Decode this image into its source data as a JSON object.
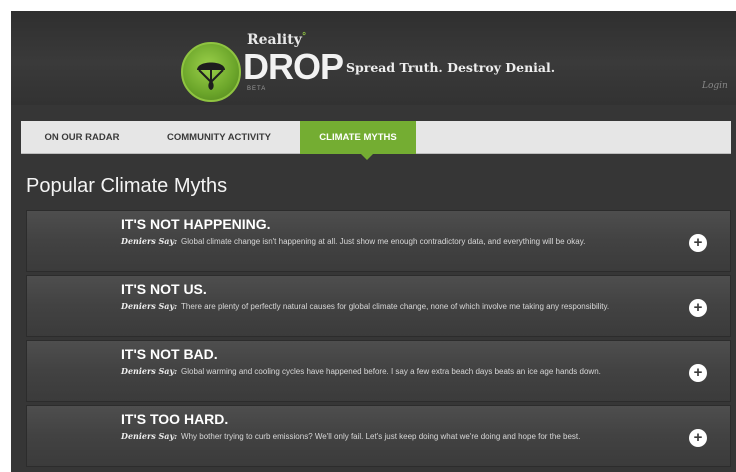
{
  "header": {
    "brand_small": "Reality",
    "brand_degree": "°",
    "brand_big": "DROP",
    "brand_beta": "BETA",
    "tagline": "Spread Truth. Destroy Denial.",
    "login_label": "Login"
  },
  "nav": {
    "tabs": [
      {
        "label": "ON OUR RADAR"
      },
      {
        "label": "COMMUNITY ACTIVITY"
      },
      {
        "label": "CLIMATE MYTHS"
      }
    ]
  },
  "main": {
    "title": "Popular Climate Myths",
    "lead_label": "Deniers Say:",
    "myths": [
      {
        "title": "IT'S NOT HAPPENING.",
        "text": "Global climate change isn't happening at all. Just show me enough contradictory data, and everything will be okay."
      },
      {
        "title": "IT'S NOT US.",
        "text": "There are plenty of perfectly natural causes for global climate change, none of which involve me taking any responsibility."
      },
      {
        "title": "IT'S NOT BAD.",
        "text": "Global warming and cooling cycles have happened before. I say a few extra beach days beats an ice age hands down."
      },
      {
        "title": "IT'S TOO HARD.",
        "text": "Why bother trying to curb emissions? We'll only fail. Let's just keep doing what we're doing and hope for the best."
      }
    ],
    "expand_symbol": "+"
  },
  "colors": {
    "accent": "#74ad32",
    "background": "#363636",
    "nav_background": "#e6e6e6"
  },
  "icons": {
    "logo": "parachute-drop-icon",
    "expand": "plus-icon"
  }
}
